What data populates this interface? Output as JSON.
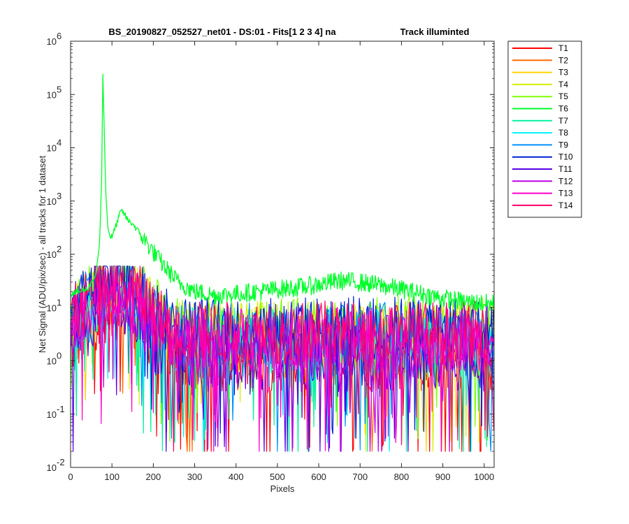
{
  "chart_data": {
    "type": "line",
    "title_left": "BS_20190827_052527_net01 - DS:01 - Fits[1  2  3  4]   na",
    "title_right": "Track illuminted",
    "xlabel": "Pixels",
    "ylabel": "Net Signal (ADU/pix/sec) - all tracks for 1 dataset",
    "xlim": [
      0,
      1024
    ],
    "ylim": [
      0.01,
      1000000
    ],
    "yscale": "log",
    "xticks": [
      "0",
      "100",
      "200",
      "300",
      "400",
      "500",
      "600",
      "700",
      "800",
      "900",
      "1000"
    ],
    "yticks": [
      {
        "base": "10",
        "exp": "-2"
      },
      {
        "base": "10",
        "exp": "-1"
      },
      {
        "base": "10",
        "exp": "0"
      },
      {
        "base": "10",
        "exp": "1"
      },
      {
        "base": "10",
        "exp": "2"
      },
      {
        "base": "10",
        "exp": "3"
      },
      {
        "base": "10",
        "exp": "4"
      },
      {
        "base": "10",
        "exp": "5"
      },
      {
        "base": "10",
        "exp": "6"
      }
    ],
    "legend_position": "outside-right",
    "series": [
      {
        "name": "T1",
        "color": "#ff0000"
      },
      {
        "name": "T2",
        "color": "#ff6a00"
      },
      {
        "name": "T3",
        "color": "#ffd400"
      },
      {
        "name": "T4",
        "color": "#d4f000"
      },
      {
        "name": "T5",
        "color": "#80ff00"
      },
      {
        "name": "T6",
        "color": "#00ff2a",
        "values": [
          [
            0,
            18
          ],
          [
            40,
            22
          ],
          [
            60,
            40
          ],
          [
            70,
            150
          ],
          [
            75,
            2500
          ],
          [
            78,
            240000
          ],
          [
            81,
            30000
          ],
          [
            85,
            1500
          ],
          [
            90,
            320
          ],
          [
            95,
            220
          ],
          [
            100,
            210
          ],
          [
            110,
            350
          ],
          [
            120,
            600
          ],
          [
            125,
            650
          ],
          [
            130,
            560
          ],
          [
            140,
            420
          ],
          [
            150,
            380
          ],
          [
            170,
            230
          ],
          [
            200,
            110
          ],
          [
            230,
            55
          ],
          [
            260,
            30
          ],
          [
            300,
            20
          ],
          [
            350,
            17
          ],
          [
            400,
            18
          ],
          [
            450,
            20
          ],
          [
            500,
            22
          ],
          [
            550,
            24
          ],
          [
            600,
            27
          ],
          [
            650,
            32
          ],
          [
            700,
            30
          ],
          [
            750,
            26
          ],
          [
            800,
            22
          ],
          [
            850,
            18
          ],
          [
            900,
            15
          ],
          [
            950,
            13
          ],
          [
            1000,
            12
          ],
          [
            1024,
            12
          ]
        ]
      },
      {
        "name": "T7",
        "color": "#00f0a0"
      },
      {
        "name": "T8",
        "color": "#00f0ff"
      },
      {
        "name": "T9",
        "color": "#0090ff"
      },
      {
        "name": "T10",
        "color": "#0022d4"
      },
      {
        "name": "T11",
        "color": "#5a00e6"
      },
      {
        "name": "T12",
        "color": "#c000e6"
      },
      {
        "name": "T13",
        "color": "#ff00c8"
      },
      {
        "name": "T14",
        "color": "#ff0066"
      }
    ]
  }
}
